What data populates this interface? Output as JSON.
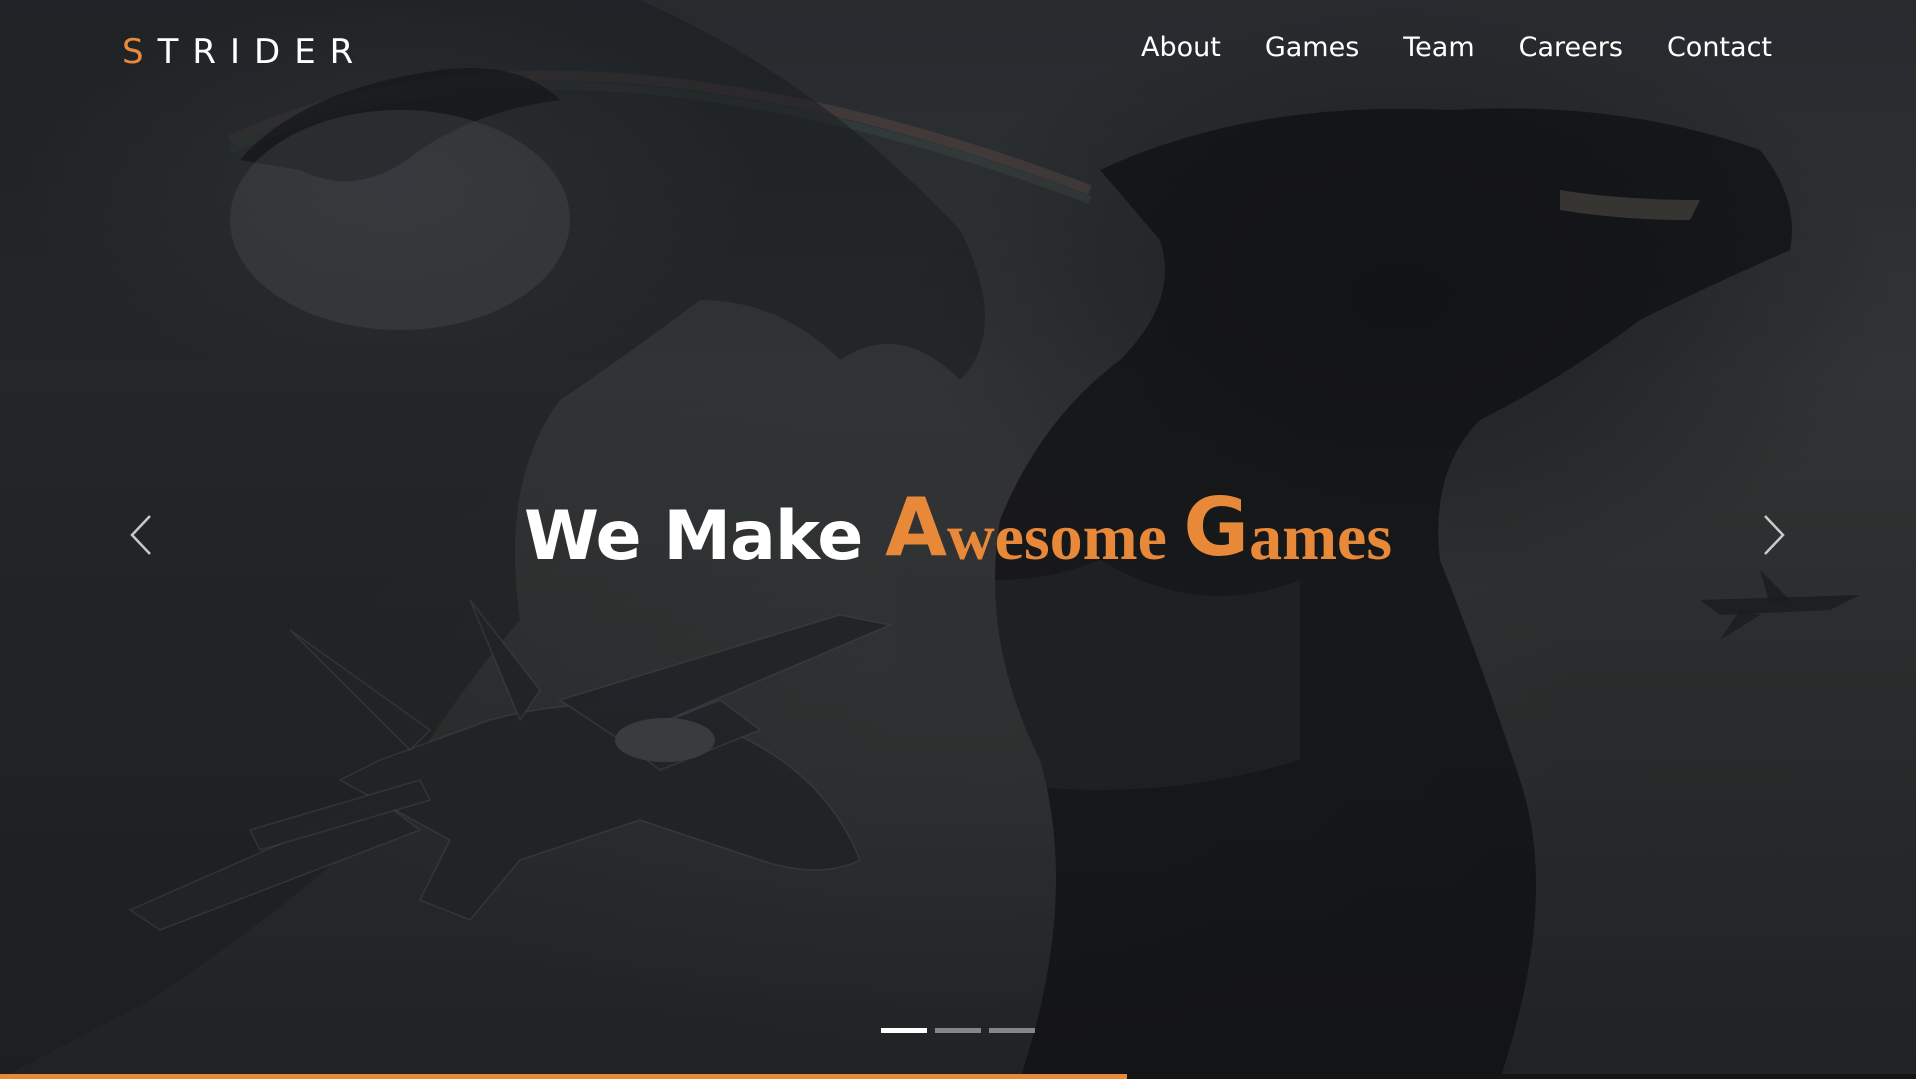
{
  "brand": {
    "logo_first": "S",
    "logo_rest": "TRIDER",
    "accent_color": "#e8893a"
  },
  "nav": {
    "items": [
      {
        "label": "About"
      },
      {
        "label": "Games"
      },
      {
        "label": "Team"
      },
      {
        "label": "Careers"
      },
      {
        "label": "Contact"
      }
    ]
  },
  "hero": {
    "headline_white": "We Make ",
    "headline_accent_1_cap": "A",
    "headline_accent_1_rest": "wesome ",
    "headline_accent_2_cap": "G",
    "headline_accent_2_rest": "ames",
    "prev_icon": "chevron-left-icon",
    "next_icon": "chevron-right-icon"
  },
  "carousel": {
    "slide_count": 3,
    "active_index": 0,
    "progress_fraction": 0.588
  }
}
